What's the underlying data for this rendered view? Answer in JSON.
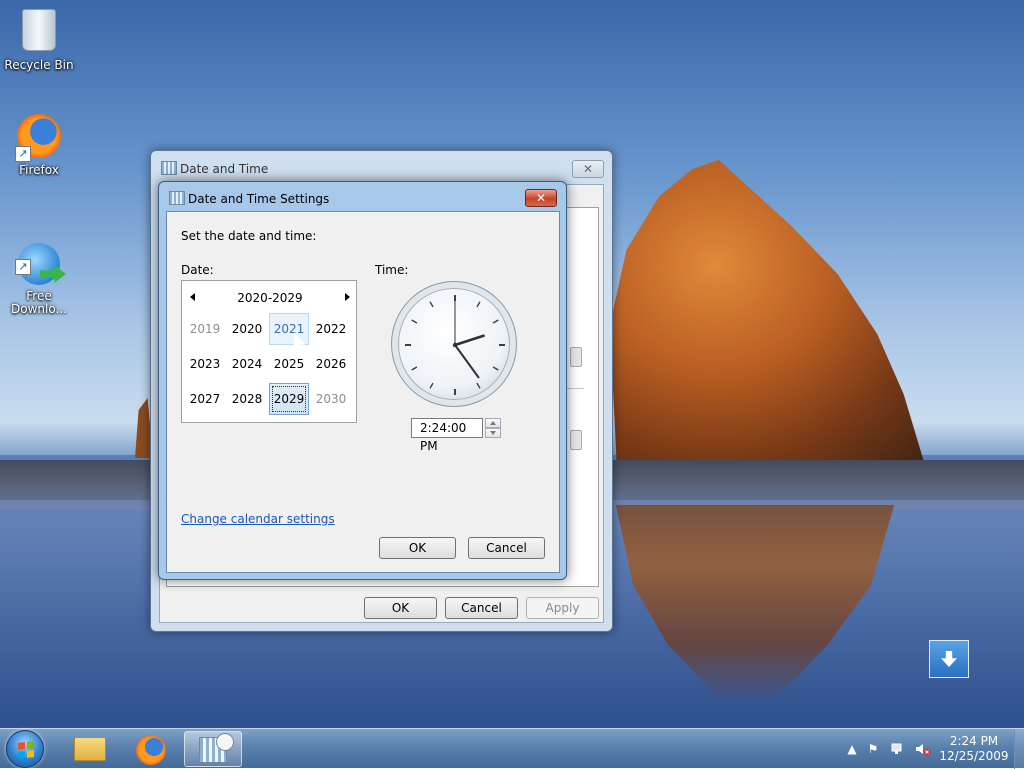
{
  "desktop": {
    "icons": [
      {
        "label": "Recycle Bin",
        "icon": "recycle-bin-icon"
      },
      {
        "label": "Firefox",
        "icon": "firefox-icon"
      },
      {
        "label": "Free\nDownlo...",
        "icon": "download-icon"
      }
    ]
  },
  "outer_dialog": {
    "title": "Date and Time",
    "close_glyph": "✕",
    "buttons": {
      "ok": "OK",
      "cancel": "Cancel",
      "apply": "Apply"
    }
  },
  "inner_dialog": {
    "title": "Date and Time Settings",
    "close_glyph": "✕",
    "heading": "Set the date and time:",
    "date_label": "Date:",
    "time_label": "Time:",
    "calendar": {
      "decade_title": "2020-2029",
      "cells": [
        {
          "text": "2019",
          "state": "dim"
        },
        {
          "text": "2020",
          "state": "normal"
        },
        {
          "text": "2021",
          "state": "hover"
        },
        {
          "text": "2022",
          "state": "normal"
        },
        {
          "text": "2023",
          "state": "normal"
        },
        {
          "text": "2024",
          "state": "normal"
        },
        {
          "text": "2025",
          "state": "normal"
        },
        {
          "text": "2026",
          "state": "normal"
        },
        {
          "text": "2027",
          "state": "normal"
        },
        {
          "text": "2028",
          "state": "normal"
        },
        {
          "text": "2029",
          "state": "selected"
        },
        {
          "text": "2030",
          "state": "dim"
        }
      ]
    },
    "time_value": "2:24:00 PM",
    "link": "Change calendar settings",
    "buttons": {
      "ok": "OK",
      "cancel": "Cancel"
    }
  },
  "taskbar": {
    "clock_time": "2:24 PM",
    "clock_date": "12/25/2009",
    "tray_up_glyph": "▲",
    "tray_flag_glyph": "⚑"
  },
  "colors": {
    "accent_link": "#1a57b8",
    "close_button_active": "#c7432a",
    "taskbar": "#5a81ad"
  }
}
